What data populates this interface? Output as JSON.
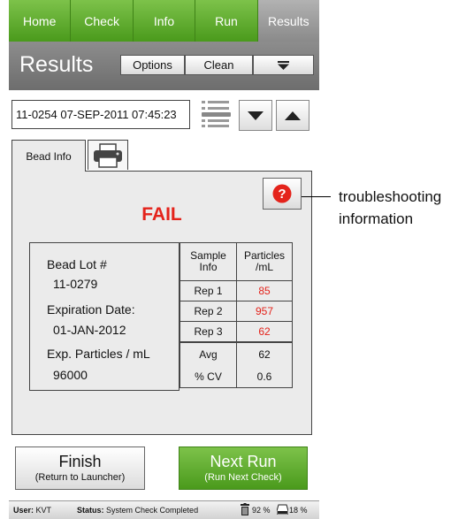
{
  "nav": {
    "tabs": [
      "Home",
      "Check",
      "Info",
      "Run",
      "Results"
    ],
    "active": "Results"
  },
  "header": {
    "title": "Results",
    "options_label": "Options",
    "clean_label": "Clean",
    "menu_icon": "triangle-down-icon"
  },
  "run_selector": {
    "value": "11-0254 07-SEP-2011 07:45:23"
  },
  "tabs": {
    "bead_info": "Bead Info",
    "print_icon": "printer-icon"
  },
  "result": {
    "status": "FAIL",
    "status_color": "#e4231b"
  },
  "bead": {
    "lot_label": "Bead Lot #",
    "lot_value": "11-0279",
    "expiration_label": "Expiration Date:",
    "expiration_value": "01-JAN-2012",
    "exp_particles_label": "Exp. Particles / mL",
    "exp_particles_value": "96000"
  },
  "table": {
    "header_col1_line1": "Sample",
    "header_col1_line2": "Info",
    "header_col2_line1": "Particles",
    "header_col2_line2": "/mL",
    "reps": [
      {
        "label": "Rep 1",
        "value": "85"
      },
      {
        "label": "Rep 2",
        "value": "957"
      },
      {
        "label": "Rep 3",
        "value": "62"
      }
    ],
    "stats": [
      {
        "label": "Avg",
        "value": "62"
      },
      {
        "label": "% CV",
        "value": "0.6"
      }
    ]
  },
  "buttons": {
    "finish": "Finish",
    "finish_sub": "(Return to Launcher)",
    "next": "Next Run",
    "next_sub": "(Run Next Check)"
  },
  "statusbar": {
    "user_label": "User:",
    "user_value": "KVT",
    "status_label": "Status:",
    "status_value": "System Check Completed",
    "trash_value": "92 %",
    "disk_value": "18 %"
  },
  "callout": {
    "line1": "troubleshooting",
    "line2": "information"
  },
  "colors": {
    "accent_green": "#5aab28",
    "header_gray": "#7b7b7b",
    "fail_red": "#e4231b"
  }
}
